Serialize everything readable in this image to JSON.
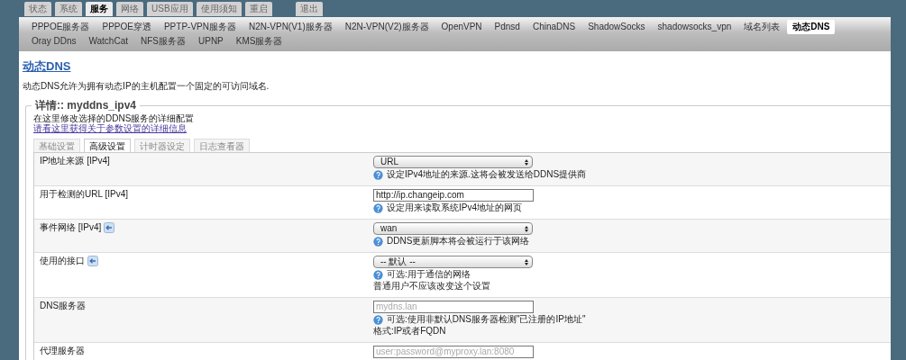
{
  "main_tabs": [
    {
      "label": "状态",
      "selected": false
    },
    {
      "label": "系统",
      "selected": false
    },
    {
      "label": "服务",
      "selected": true
    },
    {
      "label": "网络",
      "selected": false
    },
    {
      "label": "USB应用",
      "selected": false
    },
    {
      "label": "使用须知",
      "selected": false
    },
    {
      "label": "重启",
      "selected": false
    },
    {
      "label": "退出",
      "selected": false
    }
  ],
  "sub_nav": [
    {
      "label": "PPPOE服务器",
      "selected": false
    },
    {
      "label": "PPPOE穿透",
      "selected": false
    },
    {
      "label": "PPTP-VPN服务器",
      "selected": false
    },
    {
      "label": "N2N-VPN(V1)服务器",
      "selected": false
    },
    {
      "label": "N2N-VPN(V2)服务器",
      "selected": false
    },
    {
      "label": "OpenVPN",
      "selected": false
    },
    {
      "label": "Pdnsd",
      "selected": false
    },
    {
      "label": "ChinaDNS",
      "selected": false
    },
    {
      "label": "ShadowSocks",
      "selected": false
    },
    {
      "label": "shadowsocks_vpn",
      "selected": false
    },
    {
      "label": "域名列表",
      "selected": false
    },
    {
      "label": "动态DNS",
      "selected": true
    },
    {
      "label": "Oray DDns",
      "selected": false
    },
    {
      "label": "WatchCat",
      "selected": false
    },
    {
      "label": "NFS服务器",
      "selected": false
    },
    {
      "label": "UPNP",
      "selected": false
    },
    {
      "label": "KMS服务器",
      "selected": false
    }
  ],
  "page_title": "动态DNS",
  "description": "动态DNS允许为拥有动态IP的主机配置一个固定的可访问域名.",
  "fieldset": {
    "legend": "详情:: myddns_ipv4",
    "intro": "在这里修改选择的DDNS服务的详细配置",
    "help_link": "请看这里获得关于参数设置的详细信息"
  },
  "section_tabs": [
    {
      "label": "基础设置",
      "selected": false
    },
    {
      "label": "高级设置",
      "selected": true
    },
    {
      "label": "计时器设定",
      "selected": false
    },
    {
      "label": "日志查看器",
      "selected": false
    }
  ],
  "rows": [
    {
      "label": "IP地址来源 [IPv4]",
      "has_icon": false,
      "kind": "select",
      "value": "URL",
      "help": "设定IPv4地址的来源.这将会被发送给DDNS提供商"
    },
    {
      "label": "用于检测的URL [IPv4]",
      "has_icon": false,
      "kind": "text",
      "value": "http://ip.changeip.com",
      "help": "设定用来读取系统IPv4地址的网页"
    },
    {
      "label": "事件网络 [IPv4]",
      "has_icon": true,
      "kind": "select",
      "value": "wan",
      "help": "DDNS更新脚本将会被运行于该网络"
    },
    {
      "label": "使用的接口",
      "has_icon": true,
      "kind": "select",
      "value": "-- 默认 --",
      "help": "可选:用于通信的网络",
      "note": "普通用户不应该改变这个设置"
    },
    {
      "label": "DNS服务器",
      "has_icon": false,
      "kind": "text",
      "placeholder": "mydns.lan",
      "help": "可选:使用非默认DNS服务器检测\"已注册的IP地址\"",
      "note": "格式:IP或者FQDN"
    },
    {
      "label": "代理服务器",
      "has_icon": false,
      "kind": "text",
      "placeholder": "user:password@myproxy.lan:8080"
    }
  ]
}
